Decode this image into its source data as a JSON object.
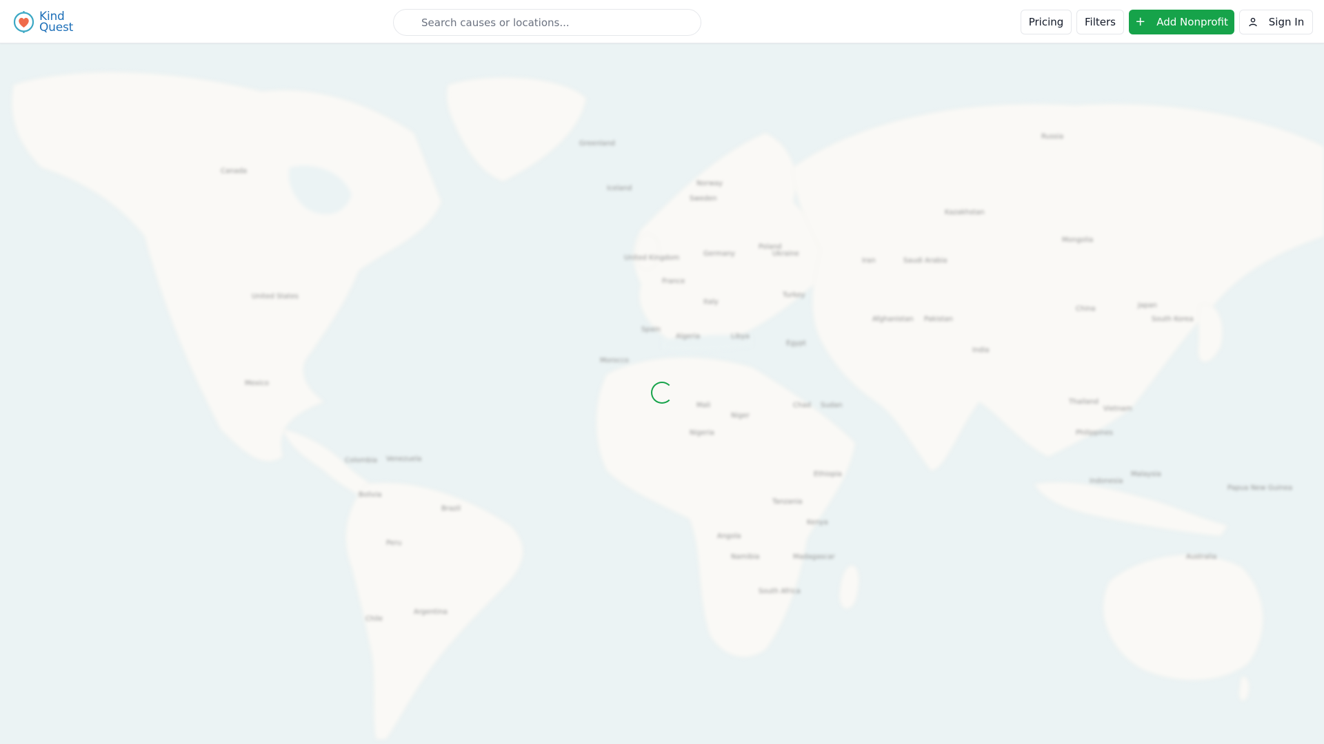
{
  "app": {
    "brand_line1": "Kind",
    "brand_line2": "Quest",
    "brand_color": "#1d6fb8",
    "accent_color": "#16a34a",
    "heart_color": "#ef6b4a"
  },
  "search": {
    "placeholder": "Search causes or locations...",
    "value": ""
  },
  "nav": {
    "pricing_label": "Pricing",
    "filters_label": "Filters",
    "add_label": "Add Nonprofit",
    "add_icon": "plus-icon",
    "signin_label": "Sign In",
    "signin_icon": "user-icon"
  },
  "map": {
    "state": "loading",
    "background_color": "#ebf3f4",
    "land_color": "#faf9f6",
    "spinner_icon": "loading-spinner-icon",
    "place_labels": [
      "Canada",
      "United States",
      "Mexico",
      "Colombia",
      "Venezuela",
      "Peru",
      "Brazil",
      "Bolivia",
      "Argentina",
      "Chile",
      "Greenland",
      "Iceland",
      "Norway",
      "Sweden",
      "United Kingdom",
      "France",
      "Spain",
      "Germany",
      "Poland",
      "Italy",
      "Ukraine",
      "Turkey",
      "Algeria",
      "Libya",
      "Egypt",
      "Mali",
      "Niger",
      "Chad",
      "Sudan",
      "Nigeria",
      "Ethiopia",
      "Kenya",
      "Tanzania",
      "Angola",
      "Namibia",
      "South Africa",
      "Madagascar",
      "Saudi Arabia",
      "Iran",
      "Kazakhstan",
      "Russia",
      "Mongolia",
      "China",
      "India",
      "Pakistan",
      "Afghanistan",
      "Japan",
      "South Korea",
      "Thailand",
      "Vietnam",
      "Philippines",
      "Indonesia",
      "Malaysia",
      "Papua New Guinea",
      "Australia",
      "Morocco"
    ]
  }
}
